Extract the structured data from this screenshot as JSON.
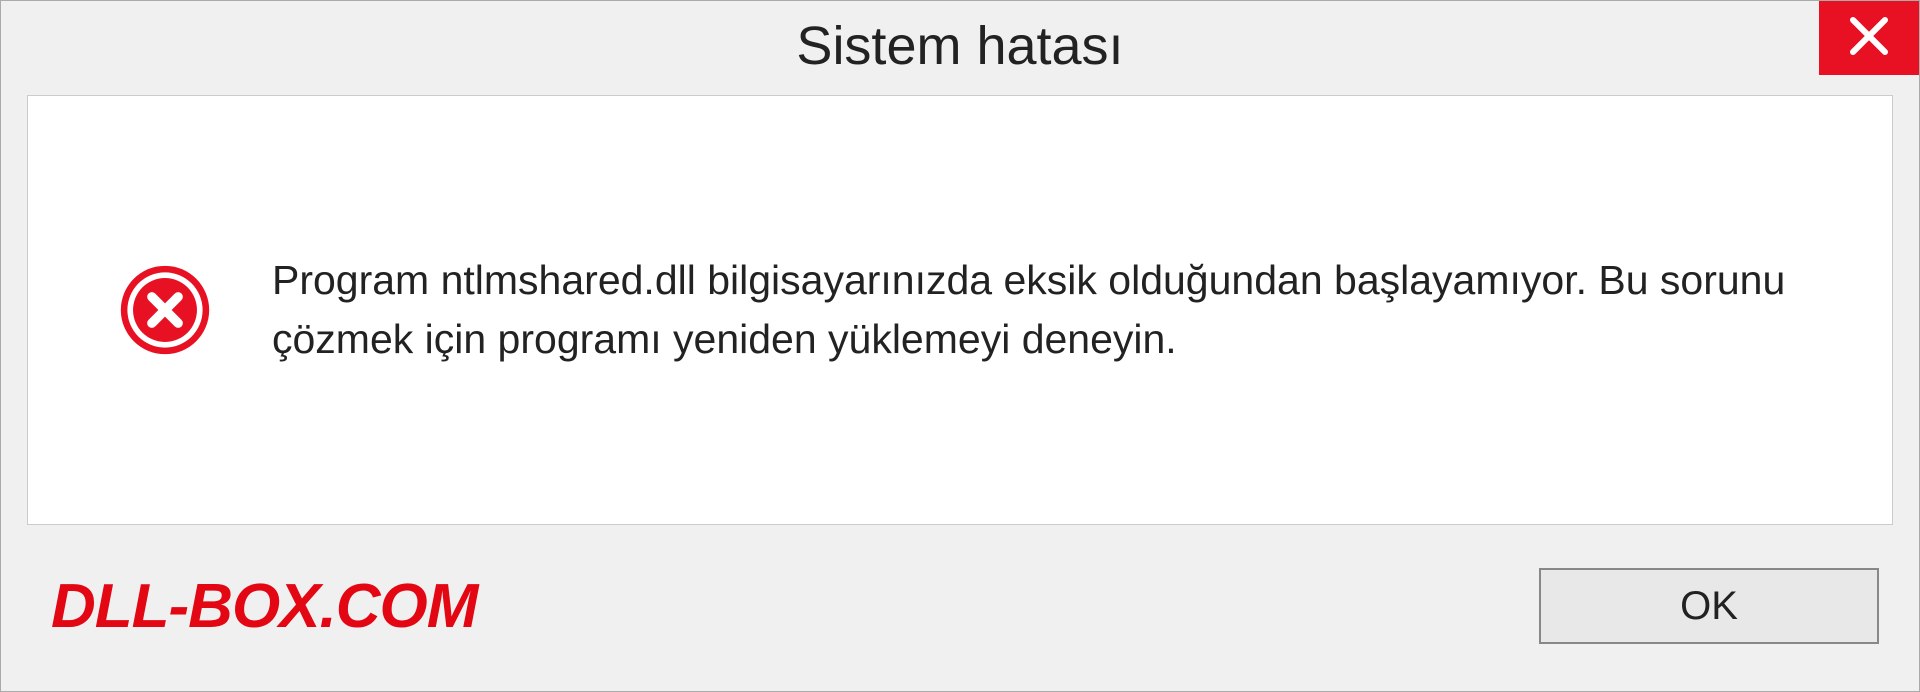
{
  "titlebar": {
    "title": "Sistem hatası"
  },
  "content": {
    "message": "Program ntlmshared.dll bilgisayarınızda eksik olduğundan başlayamıyor. Bu sorunu çözmek için programı yeniden yüklemeyi deneyin."
  },
  "footer": {
    "watermark": "DLL-BOX.COM",
    "ok_label": "OK"
  },
  "colors": {
    "close_bg": "#e81123",
    "error_icon": "#e81123",
    "watermark": "#e30613"
  }
}
